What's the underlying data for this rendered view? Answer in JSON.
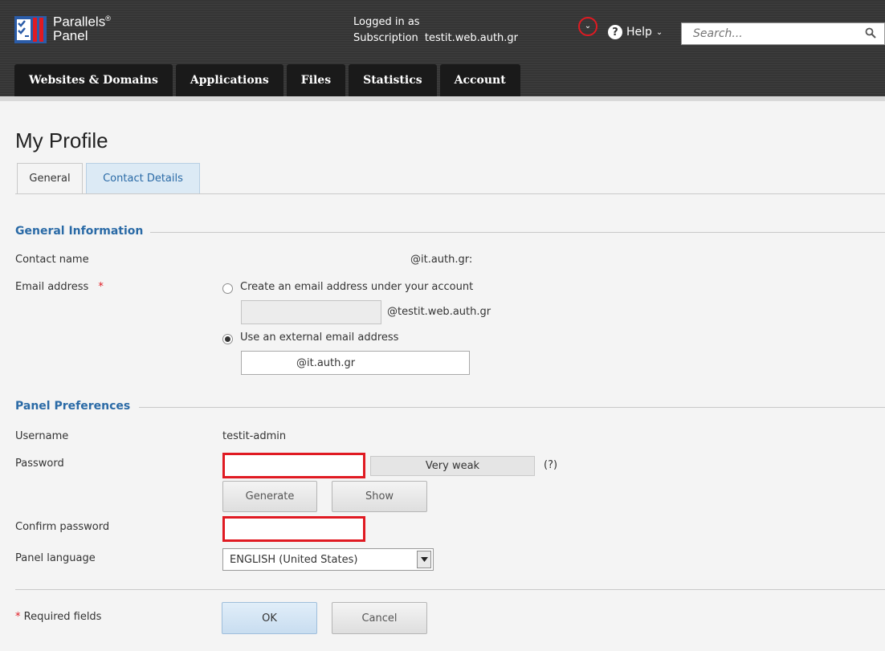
{
  "header": {
    "brand_line1": "Parallels",
    "brand_reg": "®",
    "brand_line2": "Panel",
    "logged_in_label": "Logged in as",
    "subscription_label": "Subscription",
    "subscription_value": "testit.web.auth.gr",
    "user_menu_glyph": "⌄",
    "help_label": "Help",
    "search_placeholder": "Search..."
  },
  "nav": {
    "items": [
      {
        "label": "Websites & Domains"
      },
      {
        "label": "Applications"
      },
      {
        "label": "Files"
      },
      {
        "label": "Statistics"
      },
      {
        "label": "Account"
      }
    ]
  },
  "page": {
    "title": "My Profile",
    "tabs": [
      {
        "label": "General",
        "active": true
      },
      {
        "label": "Contact Details",
        "active": false
      }
    ]
  },
  "general_info": {
    "title": "General Information",
    "contact_name_label": "Contact name",
    "contact_name_value": "@it.auth.gr:",
    "email_label": "Email address",
    "required_mark": "*",
    "option_internal_label": "Create an email address under your account",
    "internal_domain": "@testit.web.auth.gr",
    "internal_value": "",
    "option_external_label": "Use an external email address",
    "external_value": "@it.auth.gr",
    "selected_option": "external"
  },
  "panel_prefs": {
    "title": "Panel Preferences",
    "username_label": "Username",
    "username_value": "testit-admin",
    "password_label": "Password",
    "password_value": "",
    "strength_text": "Very weak",
    "strength_hint": "(?)",
    "generate_label": "Generate",
    "show_label": "Show",
    "confirm_label": "Confirm password",
    "confirm_value": "",
    "language_label": "Panel language",
    "language_value": "ENGLISH (United States)"
  },
  "footer": {
    "required_note": "Required fields",
    "ok_label": "OK",
    "cancel_label": "Cancel"
  },
  "colors": {
    "accent": "#2a6aa6",
    "error": "#e01a22",
    "header_bg": "#353535",
    "tab_inactive_bg": "#dceaf5"
  }
}
